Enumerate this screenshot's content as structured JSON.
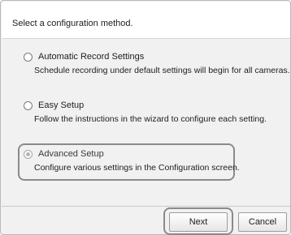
{
  "header": {
    "instruction": "Select a configuration method."
  },
  "options": [
    {
      "label": "Automatic Record Settings",
      "description": "Schedule recording under default settings will begin for all cameras.",
      "selected": false
    },
    {
      "label": "Easy Setup",
      "description": "Follow the instructions in the wizard to configure each setting.",
      "selected": false
    },
    {
      "label": "Advanced Setup",
      "description": "Configure various settings in the Configuration screen.",
      "selected": true
    }
  ],
  "buttons": {
    "next": "Next",
    "cancel": "Cancel"
  },
  "colors": {
    "highlight_border": "#8a8a8a",
    "panel_background": "#f1f1f1"
  }
}
